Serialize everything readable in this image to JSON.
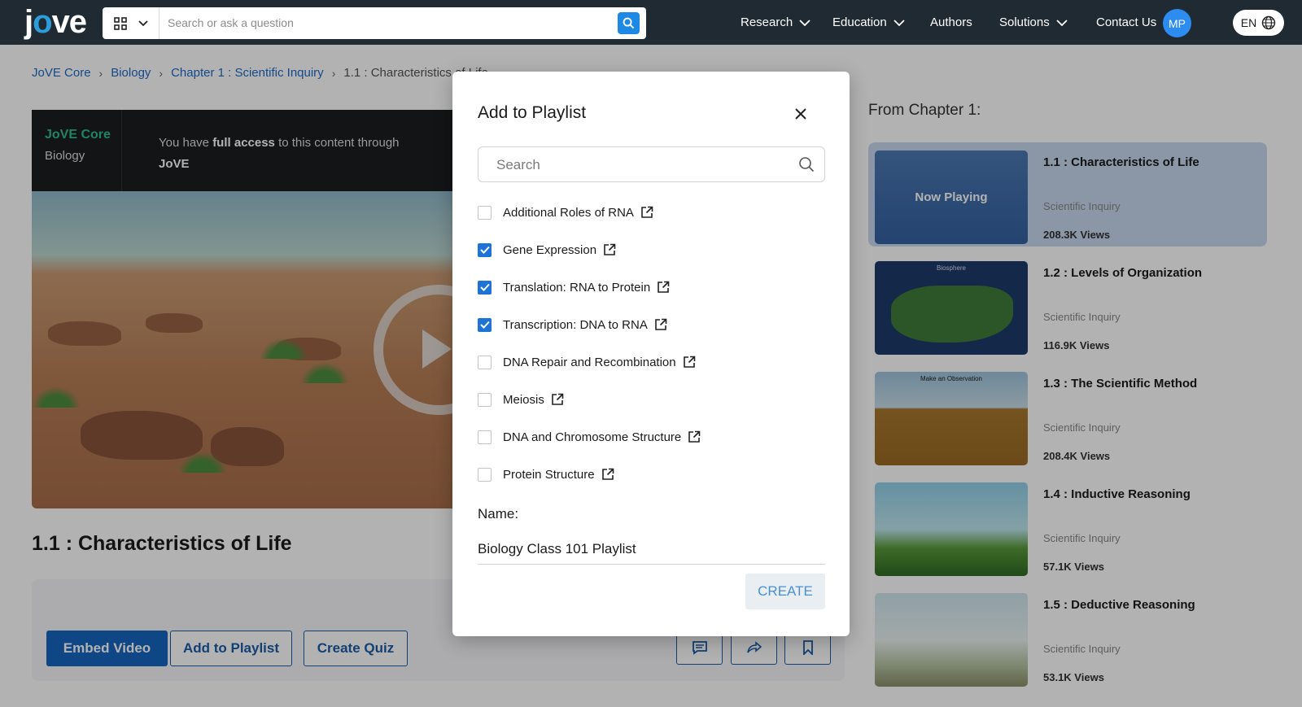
{
  "header": {
    "logo": "jove",
    "search_placeholder": "Search or ask a question",
    "nav": [
      {
        "label": "Research",
        "has_dropdown": true
      },
      {
        "label": "Education",
        "has_dropdown": true
      },
      {
        "label": "Authors",
        "has_dropdown": false
      },
      {
        "label": "Solutions",
        "has_dropdown": true
      },
      {
        "label": "Contact Us",
        "has_dropdown": false
      }
    ],
    "avatar_initials": "MP",
    "language": "EN"
  },
  "breadcrumb": [
    "JoVE Core",
    "Biology",
    "Chapter 1 : Scientific Inquiry",
    "1.1 : Characteristics of Life"
  ],
  "video": {
    "brand": "JoVE Core",
    "subject": "Biology",
    "access_prefix": "You have ",
    "access_bold": "full access",
    "access_suffix": " to this content through",
    "access_org": "JoVE"
  },
  "lesson_title": "1.1 : Characteristics of Life",
  "actions": {
    "embed": "Embed Video",
    "add_playlist": "Add to Playlist",
    "create_quiz": "Create Quiz"
  },
  "sidebar": {
    "heading": "From Chapter 1:",
    "now_playing": "Now Playing",
    "lessons": [
      {
        "title": "1.1 : Characteristics of Life",
        "category": "Scientific Inquiry",
        "views": "208.3K Views",
        "active": true
      },
      {
        "title": "1.2 : Levels of Organization",
        "category": "Scientific Inquiry",
        "views": "116.9K Views",
        "thumb_label": "Biosphere"
      },
      {
        "title": "1.3 : The Scientific Method",
        "category": "Scientific Inquiry",
        "views": "208.4K Views",
        "thumb_label": "Make an Observation"
      },
      {
        "title": "1.4 : Inductive Reasoning",
        "category": "Scientific Inquiry",
        "views": "57.1K Views"
      },
      {
        "title": "1.5 : Deductive Reasoning",
        "category": "Scientific Inquiry",
        "views": "53.1K Views"
      }
    ]
  },
  "modal": {
    "title": "Add to Playlist",
    "search_placeholder": "Search",
    "playlists": [
      {
        "label": "Additional Roles of RNA",
        "checked": false
      },
      {
        "label": "Gene Expression",
        "checked": true
      },
      {
        "label": "Translation: RNA to Protein",
        "checked": true
      },
      {
        "label": "Transcription: DNA to RNA",
        "checked": true
      },
      {
        "label": "DNA Repair and Recombination",
        "checked": false
      },
      {
        "label": "Meiosis",
        "checked": false
      },
      {
        "label": "DNA and Chromosome Structure",
        "checked": false
      },
      {
        "label": "Protein Structure",
        "checked": false
      }
    ],
    "name_label": "Name:",
    "name_value": "Biology Class 101 Playlist",
    "create_label": "CREATE"
  },
  "colors": {
    "nav_bg": "#1f2a33",
    "brand_blue": "#1565c0",
    "checkbox_blue": "#1e74d6",
    "jove_green": "#2dbf8a"
  }
}
